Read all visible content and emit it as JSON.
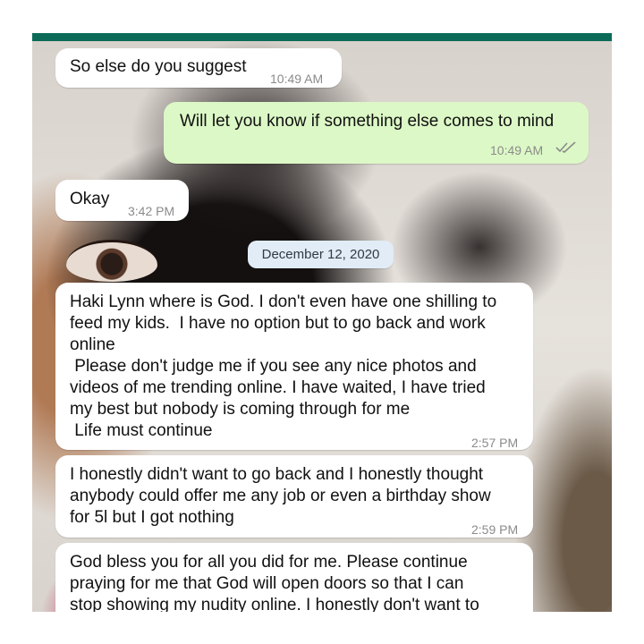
{
  "messages": [
    {
      "text": "So else do you suggest",
      "time": "10:49 AM"
    },
    {
      "text": "Will let you know if something else comes to mind",
      "time": "10:49 AM"
    },
    {
      "text": "Okay",
      "time": "3:42 PM"
    },
    {
      "text": "Haki Lynn where is God. I don't even have one shilling to\nfeed my kids.  I have no option but to go back and work\nonline\n Please don't judge me if you see any nice photos and\nvideos of me trending online. I have waited, I have tried\nmy best but nobody is coming through for me\n Life must continue",
      "time": "2:57 PM"
    },
    {
      "text": "I honestly didn't want to go back and I honestly thought\nanybody could offer me any job or even a birthday show\nfor 5l but I got nothing",
      "time": "2:59 PM"
    },
    {
      "text": "God bless you for all you did for me. Please continue\npraying for me that God will open doors so that I can\nstop showing my nudity online. I honestly don't want to",
      "time": ""
    }
  ],
  "date_separator": "December 12, 2020",
  "colors": {
    "header": "#0c6b58",
    "incoming_bubble": "#ffffff",
    "outgoing_bubble": "#dcf8c6",
    "date_chip": "#e1ecf6",
    "read_ticks": "#8b8b8b"
  },
  "icons": {
    "read_receipt": "double-check-icon"
  }
}
